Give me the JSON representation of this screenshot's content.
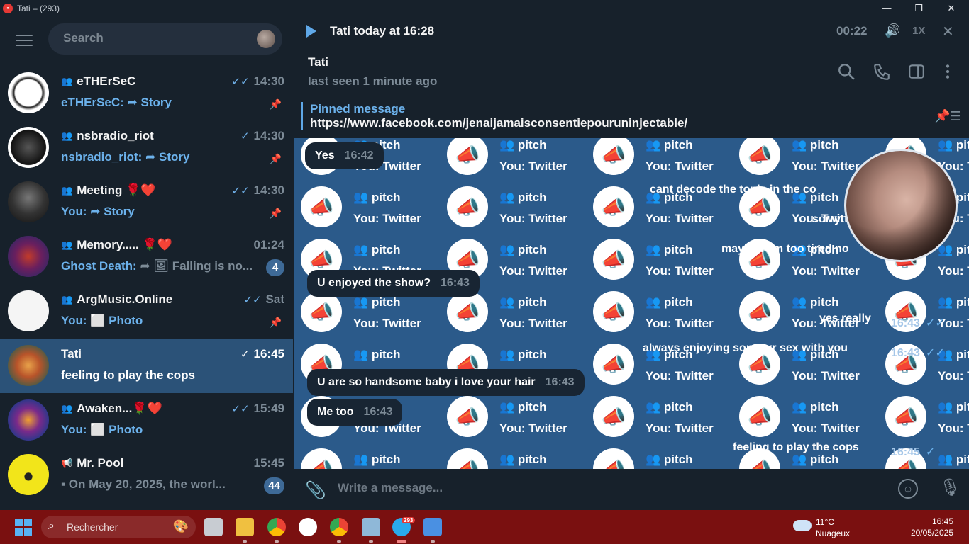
{
  "window": {
    "title": "Tati – (293)",
    "minimize": "—",
    "maximize": "❐",
    "close": "✕"
  },
  "sidebar": {
    "search_placeholder": "Search",
    "chats": [
      {
        "name": "eTHErSeC",
        "time": "14:30",
        "check": "✓✓",
        "who": "eTHErSeC:",
        "preview": " ➦ Story",
        "pinned": true,
        "group": true
      },
      {
        "name": "nsbradio_riot",
        "time": "14:30",
        "check": "✓",
        "who": "nsbradio_riot:",
        "preview": " ➦ Story",
        "pinned": true,
        "group": true
      },
      {
        "name": "Meeting 🌹❤️",
        "time": "14:30",
        "check": "✓✓",
        "who": "You:",
        "preview": " ➦ Story",
        "pinned": true,
        "group": true
      },
      {
        "name": "Memory..... 🌹❤️",
        "time": "01:24",
        "check": "",
        "who": "Ghost Death:",
        "preview": " ➦ 🖼 Falling is no...",
        "badge": "4",
        "group": true
      },
      {
        "name": "ArgMusic.Online",
        "time": "Sat",
        "check": "✓✓",
        "who": "You:",
        "preview": " ⬜ Photo",
        "pinned": true,
        "group": true
      },
      {
        "name": "Tati",
        "time": "16:45",
        "check": "✓",
        "who": "",
        "preview": "feeling to play the cops",
        "active": true
      },
      {
        "name": "Awaken...🌹❤️",
        "time": "15:49",
        "check": "✓✓",
        "who": "You:",
        "preview": " ⬜ Photo",
        "group": true
      },
      {
        "name": "Mr. Pool",
        "time": "15:45",
        "check": "",
        "who": "",
        "preview": "▪ On May 20, 2025, the worl...",
        "badge": "44",
        "channel": true
      }
    ]
  },
  "player": {
    "title": "Tati today at 16:28",
    "duration": "00:22",
    "speed": "1X"
  },
  "chat": {
    "name": "Tati",
    "status": "last seen 1 minute ago",
    "pinned_title": "Pinned message",
    "pinned_text": "https://www.facebook.com/jenaijamaisconsentiepouruninjectable/"
  },
  "tile_text": {
    "t1": "👥 pitch",
    "t2": "You: Twitter"
  },
  "messages": [
    {
      "type": "in",
      "text": "Yes",
      "time": "16:42"
    },
    {
      "type": "out",
      "text": "cant decode the topic in the co",
      "time": ""
    },
    {
      "type": "out",
      "text": "sorry",
      "time": ""
    },
    {
      "type": "out",
      "text": "maybe i am too tired no",
      "time": ""
    },
    {
      "type": "in",
      "text": "U enjoyed the show?",
      "time": "16:43"
    },
    {
      "type": "out",
      "text": "yes really",
      "time": "16:43"
    },
    {
      "type": "out",
      "text": "always enjoying some vr sex with you",
      "time": "16:43"
    },
    {
      "type": "in",
      "text": "U are so handsome baby i love your hair",
      "time": "16:43"
    },
    {
      "type": "in",
      "text": "Me too",
      "time": "16:43"
    },
    {
      "type": "out",
      "text": "feeling to play the cops",
      "time": "16:45"
    }
  ],
  "composer": {
    "placeholder": "Write a message..."
  },
  "taskbar": {
    "search_label": "Rechercher",
    "telegram_badge": "293",
    "weather_temp": "11°C",
    "weather_cond": "Nuageux",
    "time": "16:45",
    "date": "20/05/2025"
  },
  "colors": {
    "accent": "#5fa8e8",
    "sidebar": "#17212b",
    "active": "#2b5278",
    "chat_bg": "#2b5a8a",
    "taskbar": "#7a1010"
  }
}
